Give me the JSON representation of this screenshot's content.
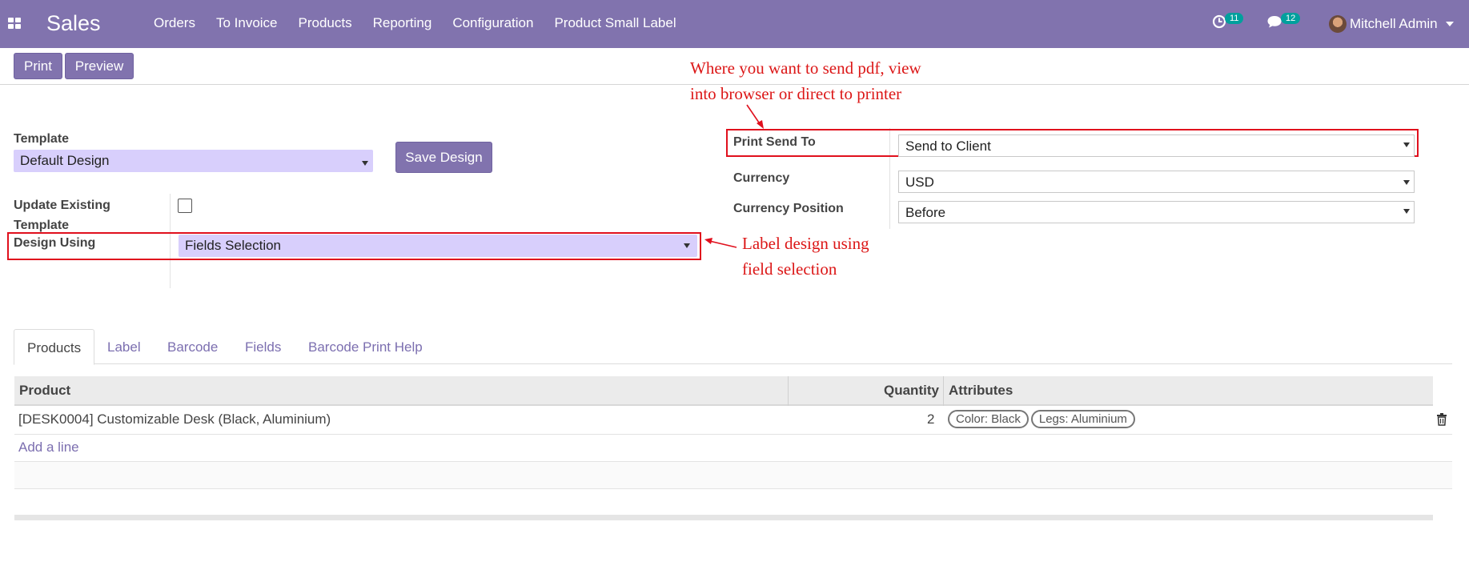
{
  "navbar": {
    "app_title": "Sales",
    "menu": [
      "Orders",
      "To Invoice",
      "Products",
      "Reporting",
      "Configuration",
      "Product Small Label"
    ],
    "activity_count": "11",
    "messages_count": "12",
    "user_name": "Mitchell Admin"
  },
  "toolbar": {
    "print_label": "Print",
    "preview_label": "Preview"
  },
  "form": {
    "template_label": "Template",
    "template_value": "Default Design",
    "save_design_label": "Save Design",
    "update_existing_label": "Update Existing Template",
    "design_using_label": "Design Using",
    "design_using_value": "Fields Selection",
    "print_send_to_label": "Print Send To",
    "print_send_to_value": "Send to Client",
    "currency_label": "Currency",
    "currency_value": "USD",
    "currency_position_label": "Currency Position",
    "currency_position_value": "Before"
  },
  "annotations": {
    "print_send_line1": "Where you want to send pdf, view",
    "print_send_line2": "into browser or direct to printer",
    "design_line1": "Label design using",
    "design_line2": "field selection"
  },
  "tabs": [
    "Products",
    "Label",
    "Barcode",
    "Fields",
    "Barcode Print Help"
  ],
  "table": {
    "headers": {
      "product": "Product",
      "quantity": "Quantity",
      "attributes": "Attributes"
    },
    "rows": [
      {
        "product": "[DESK0004] Customizable Desk (Black, Aluminium)",
        "quantity": "2",
        "attributes": [
          "Color: Black",
          "Legs: Aluminium"
        ]
      }
    ],
    "add_line": "Add a line"
  },
  "colors": {
    "brand": "#8173ae",
    "annotation": "#e0101d",
    "select_bg": "#d8cffc"
  }
}
